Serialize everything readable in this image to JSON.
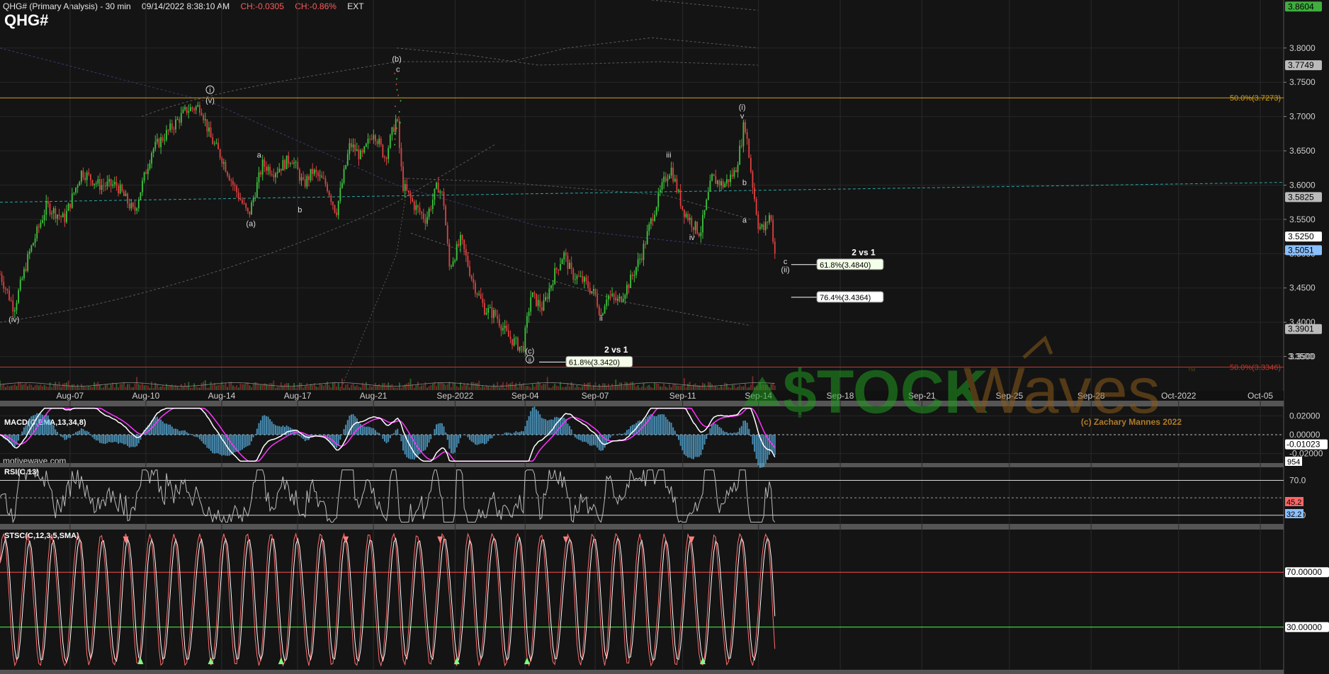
{
  "header": {
    "title": "QHG# (Primary Analysis) - 30 min",
    "datetime": "09/14/2022 8:38:10 AM",
    "change": "CH:-0.0305",
    "change_pct": "CH:-0.86%",
    "session": "EXT",
    "symbol": "QHG#"
  },
  "watermark": {
    "site": "motivewave.com",
    "brand_left": "$TOCK",
    "brand_right": "Waves",
    "tm": "™",
    "copyright": "(c) Zachary Mannes 2022"
  },
  "colors": {
    "up": "#3ec43e",
    "down": "#e04040",
    "fib_top": "#d4a017",
    "fib_bottom": "#c0392b",
    "macd": "#ffffff",
    "macd_signal": "#ff33ff",
    "macd_hist": "#5ab4e6",
    "rsi": "#bbbbbb",
    "stoch_k": "#ff6b6b",
    "stoch_d": "#ffffff",
    "trend_cyan": "#2ba5a5"
  },
  "chart_data": [
    {
      "type": "candlestick",
      "title": "QHG# (Primary Analysis) - 30 min",
      "ylim": [
        3.3,
        3.87
      ],
      "yticks": [
        3.35,
        3.4,
        3.45,
        3.5,
        3.55,
        3.6,
        3.65,
        3.7,
        3.75,
        3.8
      ],
      "ytick_labels": [
        "3.3500",
        "3.4000",
        "3.4500",
        "3.5000",
        "3.5500",
        "3.6000",
        "3.6500",
        "3.7000",
        "3.7500",
        "3.8000"
      ],
      "x_labels": [
        "Aug-07",
        "Aug-10",
        "Aug-14",
        "Aug-17",
        "Aug-21",
        "Sep-2022",
        "Sep-04",
        "Sep-07",
        "Sep-11",
        "Sep-14",
        "Sep-18",
        "Sep-21",
        "Sep-25",
        "Sep-28",
        "Oct-2022",
        "Oct-05"
      ],
      "x_label_pos": [
        0.06,
        0.125,
        0.19,
        0.255,
        0.32,
        0.39,
        0.45,
        0.51,
        0.585,
        0.65,
        0.72,
        0.79,
        0.865,
        0.935,
        1.01,
        1.08
      ],
      "x_domain": [
        0,
        1.1
      ],
      "price_path": [
        [
          0.0,
          3.47
        ],
        [
          0.012,
          3.42
        ],
        [
          0.025,
          3.5
        ],
        [
          0.04,
          3.57
        ],
        [
          0.055,
          3.55
        ],
        [
          0.07,
          3.62
        ],
        [
          0.085,
          3.6
        ],
        [
          0.1,
          3.6
        ],
        [
          0.115,
          3.56
        ],
        [
          0.13,
          3.65
        ],
        [
          0.145,
          3.68
        ],
        [
          0.16,
          3.71
        ],
        [
          0.172,
          3.715
        ],
        [
          0.18,
          3.67
        ],
        [
          0.19,
          3.64
        ],
        [
          0.2,
          3.6
        ],
        [
          0.213,
          3.555
        ],
        [
          0.225,
          3.63
        ],
        [
          0.235,
          3.62
        ],
        [
          0.25,
          3.64
        ],
        [
          0.26,
          3.6
        ],
        [
          0.268,
          3.62
        ],
        [
          0.28,
          3.6
        ],
        [
          0.288,
          3.56
        ],
        [
          0.3,
          3.66
        ],
        [
          0.31,
          3.64
        ],
        [
          0.32,
          3.68
        ],
        [
          0.33,
          3.64
        ],
        [
          0.34,
          3.7
        ],
        [
          0.345,
          3.6
        ],
        [
          0.355,
          3.57
        ],
        [
          0.365,
          3.55
        ],
        [
          0.375,
          3.6
        ],
        [
          0.38,
          3.58
        ],
        [
          0.385,
          3.48
        ],
        [
          0.395,
          3.52
        ],
        [
          0.405,
          3.46
        ],
        [
          0.415,
          3.42
        ],
        [
          0.425,
          3.41
        ],
        [
          0.435,
          3.38
        ],
        [
          0.448,
          3.36
        ],
        [
          0.455,
          3.44
        ],
        [
          0.465,
          3.42
        ],
        [
          0.475,
          3.47
        ],
        [
          0.483,
          3.5
        ],
        [
          0.49,
          3.47
        ],
        [
          0.5,
          3.46
        ],
        [
          0.51,
          3.44
        ],
        [
          0.515,
          3.41
        ],
        [
          0.52,
          3.44
        ],
        [
          0.53,
          3.43
        ],
        [
          0.54,
          3.46
        ],
        [
          0.55,
          3.5
        ],
        [
          0.56,
          3.56
        ],
        [
          0.57,
          3.61
        ],
        [
          0.575,
          3.625
        ],
        [
          0.585,
          3.565
        ],
        [
          0.595,
          3.54
        ],
        [
          0.6,
          3.53
        ],
        [
          0.61,
          3.61
        ],
        [
          0.62,
          3.6
        ],
        [
          0.63,
          3.62
        ],
        [
          0.635,
          3.66
        ],
        [
          0.638,
          3.695
        ],
        [
          0.645,
          3.6
        ],
        [
          0.65,
          3.54
        ],
        [
          0.655,
          3.535
        ],
        [
          0.66,
          3.56
        ],
        [
          0.664,
          3.5
        ]
      ],
      "annotations": [
        {
          "text": "(iv)",
          "x": 0.012,
          "y": 3.4
        },
        {
          "text": "(i)",
          "x": 0.18,
          "y": 3.735
        },
        {
          "text": "(v)",
          "x": 0.18,
          "y": 3.72
        },
        {
          "text": "a",
          "x": 0.222,
          "y": 3.64
        },
        {
          "text": "(a)",
          "x": 0.215,
          "y": 3.54
        },
        {
          "text": "b",
          "x": 0.257,
          "y": 3.56
        },
        {
          "text": "(b)",
          "x": 0.34,
          "y": 3.78
        },
        {
          "text": "c",
          "x": 0.341,
          "y": 3.765
        },
        {
          "text": "iii",
          "x": 0.573,
          "y": 3.64
        },
        {
          "text": "iv",
          "x": 0.593,
          "y": 3.52
        },
        {
          "text": "(i)",
          "x": 0.636,
          "y": 3.71
        },
        {
          "text": "v",
          "x": 0.636,
          "y": 3.697
        },
        {
          "text": "b",
          "x": 0.638,
          "y": 3.6
        },
        {
          "text": "a",
          "x": 0.638,
          "y": 3.545
        },
        {
          "text": "c",
          "x": 0.673,
          "y": 3.485
        },
        {
          "text": "(ii)",
          "x": 0.673,
          "y": 3.473
        },
        {
          "text": "ii",
          "x": 0.515,
          "y": 3.402
        },
        {
          "text": "(c)",
          "x": 0.454,
          "y": 3.354
        },
        {
          "text": "(ii)",
          "x": 0.454,
          "y": 3.342
        }
      ],
      "fib_lines": [
        {
          "label": "50.0%(3.7273)",
          "value": 3.7273,
          "full": true
        },
        {
          "label": "50.0%(3.3346)",
          "value": 3.3346,
          "full": true
        },
        {
          "label": "61.8%(3.4840)",
          "value": 3.484,
          "x0": 0.678,
          "x1": 0.7
        },
        {
          "label": "76.4%(3.4364)",
          "value": 3.4364,
          "x0": 0.678,
          "x1": 0.7
        },
        {
          "label": "61.8%(3.3420)",
          "value": 3.342,
          "x0": 0.462,
          "x1": 0.485
        }
      ],
      "vs_labels": [
        {
          "text": "2 vs 1",
          "x": 0.74,
          "y": 3.498
        },
        {
          "text": "2 vs 1",
          "x": 0.528,
          "y": 3.356
        }
      ],
      "price_tags": [
        {
          "label": "3.8604",
          "value": 3.8604,
          "bg": "#3fae3f",
          "fg": "#000000"
        },
        {
          "label": "3.7749",
          "value": 3.7749,
          "bg": "#bbbbbb",
          "fg": "#000000"
        },
        {
          "label": "3.5825",
          "value": 3.5825,
          "bg": "#bbbbbb",
          "fg": "#000000"
        },
        {
          "label": "3.5250",
          "value": 3.525,
          "bg": "#ffffff",
          "fg": "#000000"
        },
        {
          "label": "3.5051",
          "value": 3.5051,
          "bg": "#8ac0ff",
          "fg": "#000000"
        },
        {
          "label": "3.3901",
          "value": 3.3901,
          "bg": "#bbbbbb",
          "fg": "#000000"
        },
        {
          "label": "3.3500",
          "value": 3.35,
          "bg": "none",
          "fg": "#cccccc"
        }
      ],
      "volume_tag": "954"
    },
    {
      "type": "line",
      "title": "MACD(C,EMA,13,34,8)",
      "ylim": [
        -0.03,
        0.03
      ],
      "ytick_labels": [
        "0.02000",
        "0.00000",
        "-0.02000"
      ],
      "yticks": [
        0.02,
        0.0,
        -0.02
      ],
      "last_label": "-0.01023"
    },
    {
      "type": "line",
      "title": "RSI(C,13)",
      "ylim": [
        20,
        85
      ],
      "yticks": [
        70.0,
        30.0
      ],
      "ytick_labels": [
        "70.0",
        "30.0"
      ],
      "tags": [
        "45.2",
        "32.2"
      ]
    },
    {
      "type": "line",
      "title": "STSC(C,12,3,5,SMA)",
      "ylim": [
        0,
        100
      ],
      "yticks": [
        70,
        30
      ],
      "ytick_labels": [
        "70.00000",
        "30.00000"
      ]
    }
  ]
}
